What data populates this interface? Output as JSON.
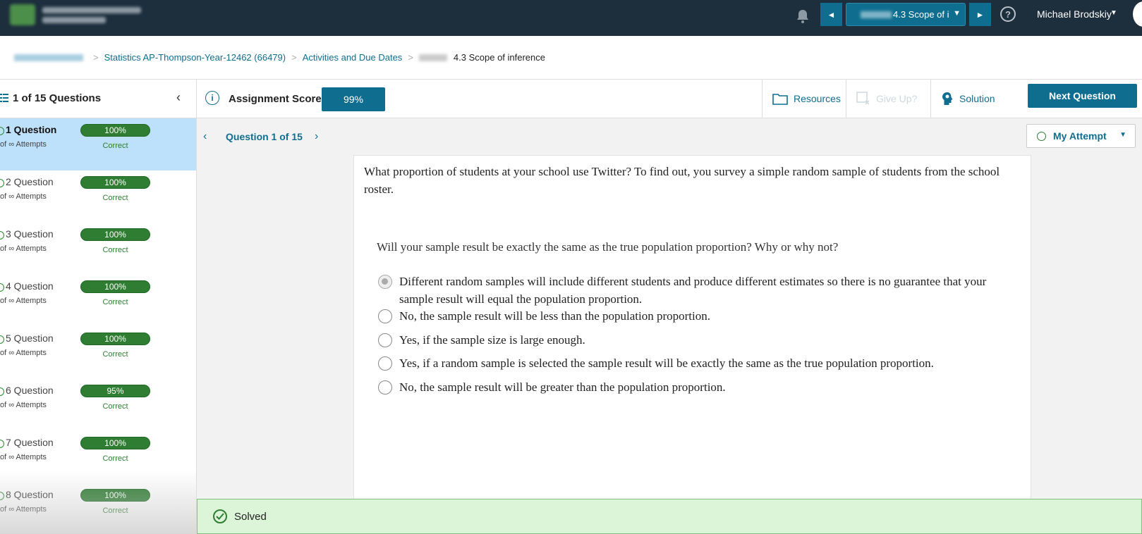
{
  "topbar": {
    "assignment_select": "4.3 Scope of i",
    "prev_arrow": "◄",
    "next_arrow": "►",
    "select_caret": "▼",
    "help": "?",
    "user_name": "Michael Brodskiy"
  },
  "breadcrumb": {
    "course": "Statistics AP-Thompson-Year-12462 (66479)",
    "section": "Activities and Due Dates",
    "current": "4.3 Scope of inference",
    "separator": ">"
  },
  "sidebar": {
    "title": "1 of 15 Questions",
    "items": [
      {
        "title": "1 Question",
        "attempts": "of ∞ Attempts",
        "score": "100%",
        "status": "Correct"
      },
      {
        "title": "2 Question",
        "attempts": "of ∞ Attempts",
        "score": "100%",
        "status": "Correct"
      },
      {
        "title": "3 Question",
        "attempts": "of ∞ Attempts",
        "score": "100%",
        "status": "Correct"
      },
      {
        "title": "4 Question",
        "attempts": "of ∞ Attempts",
        "score": "100%",
        "status": "Correct"
      },
      {
        "title": "5 Question",
        "attempts": "of ∞ Attempts",
        "score": "100%",
        "status": "Correct"
      },
      {
        "title": "6 Question",
        "attempts": "of ∞ Attempts",
        "score": "95%",
        "status": "Correct"
      },
      {
        "title": "7 Question",
        "attempts": "of ∞ Attempts",
        "score": "100%",
        "status": "Correct"
      },
      {
        "title": "8 Question",
        "attempts": "of ∞ Attempts",
        "score": "100%",
        "status": "Correct"
      }
    ]
  },
  "toolbar": {
    "score_label": "Assignment Score:",
    "score_value": "99%",
    "resources": "Resources",
    "give_up": "Give Up?",
    "solution": "Solution",
    "next_question": "Next Question"
  },
  "question_nav": {
    "counter": "Question 1 of 15",
    "my_attempt": "My Attempt"
  },
  "question": {
    "text": "What proportion of students at your school use Twitter? To find out, you survey a simple random sample of students from the school roster.",
    "prompt": "Will your sample result be exactly the same as the true population proportion? Why or why not?",
    "options": [
      "Different random samples will include different students and produce different estimates so there is no guarantee that your sample result will equal the population proportion.",
      "No, the sample result will be less than the population proportion.",
      "Yes, if the sample size is large enough.",
      "Yes, if a random sample is selected the sample result will be exactly the same as the true population proportion.",
      "No, the sample result will be greater than the population proportion."
    ],
    "selected_index": 0
  },
  "banner": {
    "status": "Solved"
  },
  "colors": {
    "topbar_bg": "#1d2e3d",
    "accent": "#0f6e8f",
    "correct_green": "#2e7d32",
    "active_item_bg": "#bde0fb",
    "solved_bg": "#dcf5d8"
  }
}
